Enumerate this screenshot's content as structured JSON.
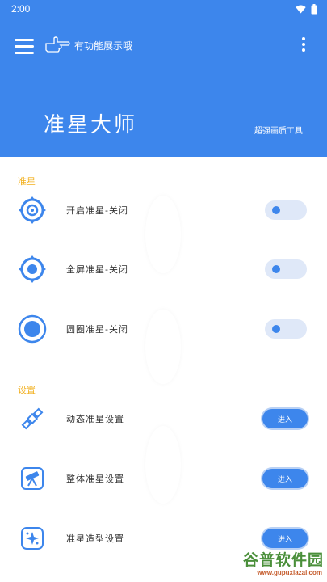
{
  "status": {
    "time": "2:00"
  },
  "header": {
    "subtitle": "有功能展示哦",
    "title": "准星大师",
    "tagline": "超强画质工具",
    "bg_color": "#3d86ec"
  },
  "sections": {
    "crosshair": {
      "label": "准星",
      "items": [
        {
          "label": "开启准星-关闭",
          "icon": "target-ring-icon",
          "control": "toggle",
          "state": "off"
        },
        {
          "label": "全屏准星-关闭",
          "icon": "scope-icon",
          "control": "toggle",
          "state": "off"
        },
        {
          "label": "圆圈准星-关闭",
          "icon": "circle-dot-icon",
          "control": "toggle",
          "state": "off"
        }
      ]
    },
    "settings": {
      "label": "设置",
      "items": [
        {
          "label": "动态准星设置",
          "icon": "satellite-icon",
          "button": "进入"
        },
        {
          "label": "整体准星设置",
          "icon": "telescope-icon",
          "button": "进入"
        },
        {
          "label": "准星造型设置",
          "icon": "sparkle-icon",
          "button": "进入"
        }
      ]
    }
  },
  "watermark": {
    "title": "谷普软件园",
    "url": "www.gupuxiazai.com"
  },
  "colors": {
    "accent": "#3d86ec",
    "section_label": "#f2b01e",
    "toggle_bg": "#dfe8f8"
  }
}
